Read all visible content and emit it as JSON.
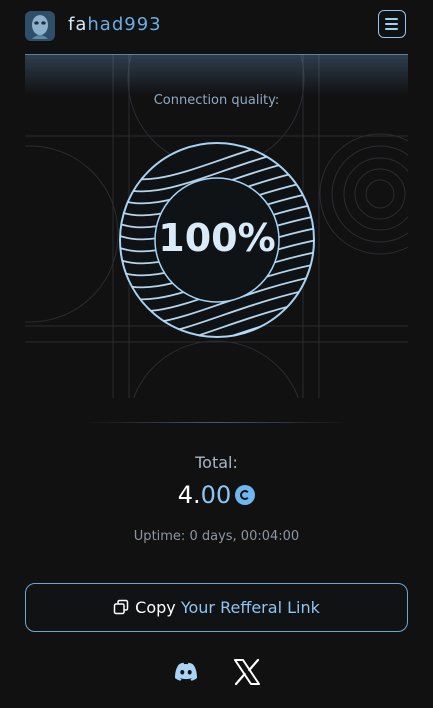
{
  "header": {
    "username_part1": "fa",
    "username_part2": "had993"
  },
  "hero": {
    "connection_label": "Connection quality:",
    "connection_value": "100%"
  },
  "stats": {
    "total_label": "Total:",
    "total_int": "4.",
    "total_dec": "00",
    "uptime": "Uptime: 0 days, 00:04:00"
  },
  "actions": {
    "copy_prefix": "Copy",
    "copy_highlight": "Your Refferal Link"
  },
  "icons": {
    "menu": "hamburger-menu-icon",
    "copy": "copy-icon",
    "discord": "discord-icon",
    "x": "x-logo-icon",
    "coin": "coin-icon"
  },
  "colors": {
    "accent": "#8cc6f2",
    "background": "#111112"
  }
}
